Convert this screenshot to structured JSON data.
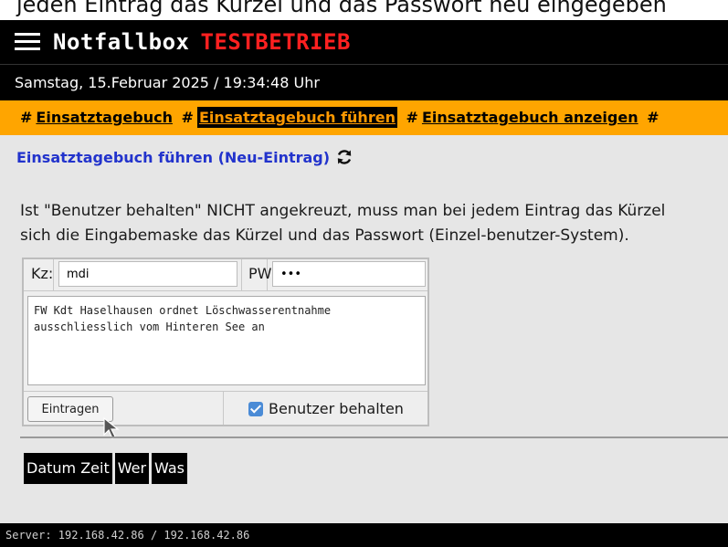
{
  "caption": "jeden Eintrag das Kürzel und das Passwort neu eingegeben",
  "header": {
    "title": "Notfallbox",
    "mode": "TESTBETRIEB"
  },
  "datetime": "Samstag, 15.Februar 2025 / 19:34:48 Uhr",
  "nav": {
    "sep": "#",
    "items": [
      {
        "label": "Einsatztagebuch"
      },
      {
        "label": "Einsatztagebuch führen"
      },
      {
        "label": "Einsatztagebuch anzeigen"
      }
    ]
  },
  "section": {
    "title": "Einsatztagebuch führen (Neu-Eintrag)"
  },
  "info": {
    "line1": "Ist \"Benutzer behalten\" NICHT angekreuzt, muss man bei jedem Eintrag das Kürzel",
    "line2": "sich die Eingabemaske das Kürzel und das Passwort (Einzel-benutzer-System)."
  },
  "form": {
    "kz_label": "Kz:",
    "kz_value": "mdi",
    "pw_label": "PW:",
    "pw_value": "•••",
    "note": "FW Kdt Haselhausen ordnet Löschwasserentnahme ausschliesslich vom Hinteren See an",
    "submit_label": "Eintragen",
    "keep_user_label": "Benutzer behalten",
    "keep_user_checked": true
  },
  "table": {
    "headers": [
      "Datum Zeit",
      "Wer",
      "Was"
    ]
  },
  "footer": "Server: 192.168.42.86 / 192.168.42.86"
}
